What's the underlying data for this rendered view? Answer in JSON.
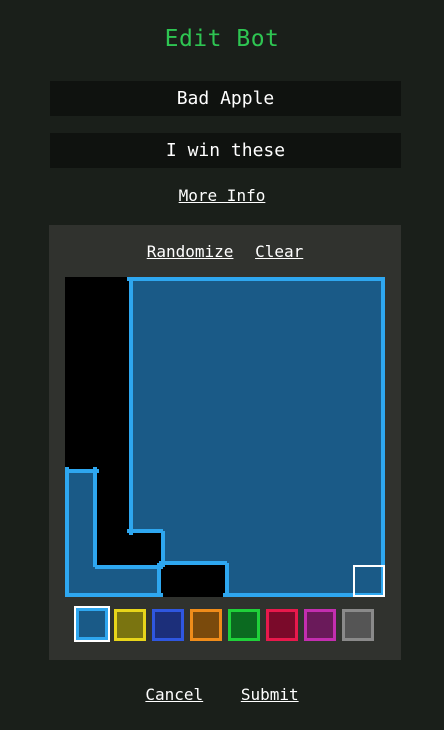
{
  "title": "Edit Bot",
  "form": {
    "name_value": "Bad Apple",
    "description_value": "I win these"
  },
  "more_info_label": "More Info",
  "editor": {
    "randomize_label": "Randomize",
    "clear_label": "Clear",
    "grid": {
      "size": 10,
      "cursor_cell": [
        9,
        9
      ],
      "cells": [
        "0011111111",
        "0011111111",
        "0011111111",
        "0011111111",
        "0011111111",
        "0011111111",
        "1011111111",
        "1011111111",
        "1001111111",
        "1110011111"
      ]
    },
    "palette": [
      {
        "name": "blue",
        "fill": "#1a5a87",
        "border": "#2ea7f0",
        "selected": true
      },
      {
        "name": "yellow",
        "fill": "#7a7410",
        "border": "#e8d51a",
        "selected": false
      },
      {
        "name": "navy",
        "fill": "#1c2f7a",
        "border": "#2f57e0",
        "selected": false
      },
      {
        "name": "orange",
        "fill": "#7a4a0c",
        "border": "#f08c1a",
        "selected": false
      },
      {
        "name": "green",
        "fill": "#0b6a20",
        "border": "#1fd13a",
        "selected": false
      },
      {
        "name": "crimson",
        "fill": "#7a0a2a",
        "border": "#e8194c",
        "selected": false
      },
      {
        "name": "magenta",
        "fill": "#6a1a5a",
        "border": "#c42eb0",
        "selected": false
      },
      {
        "name": "gray",
        "fill": "#555555",
        "border": "#8a8a8a",
        "selected": false
      }
    ]
  },
  "actions": {
    "cancel_label": "Cancel",
    "submit_label": "Submit"
  },
  "colors": {
    "background": "#1a1f1a",
    "title": "#2ec552",
    "panel": "#30322e",
    "field": "#0f120f",
    "active_fill": "#1a5a87",
    "active_border": "#2ea7f0"
  }
}
